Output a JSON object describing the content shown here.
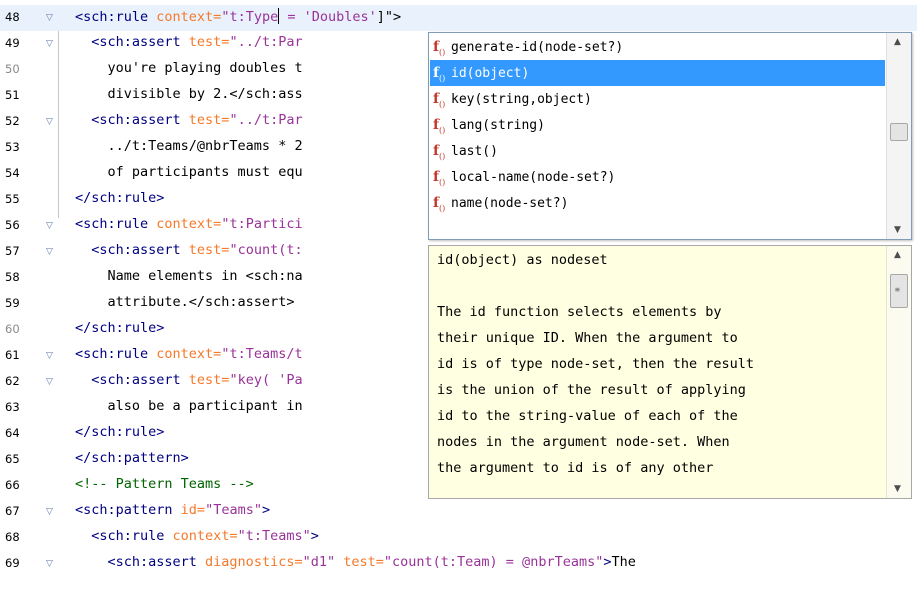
{
  "editor": {
    "lines": [
      {
        "num": "48",
        "fold": true,
        "dim": false,
        "current": true,
        "tokens": [
          [
            "tag",
            "<sch:rule "
          ],
          [
            "attr",
            "context="
          ],
          [
            "val",
            "\"t:Type"
          ],
          [
            "caret",
            ""
          ],
          [
            "val",
            " = 'Doubles'"
          ],
          [
            "text",
            "]\">"
          ]
        ]
      },
      {
        "num": "49",
        "fold": true,
        "dim": false,
        "current": false,
        "tokens": [
          [
            "tag",
            "  <sch:assert "
          ],
          [
            "attr",
            "test="
          ],
          [
            "val",
            "\"../t:Par"
          ]
        ]
      },
      {
        "num": "50",
        "fold": false,
        "dim": true,
        "current": false,
        "tokens": [
          [
            "text",
            "    you're playing doubles t"
          ]
        ]
      },
      {
        "num": "51",
        "fold": false,
        "dim": false,
        "current": false,
        "tokens": [
          [
            "text",
            "    divisible by 2.</sch:ass"
          ]
        ]
      },
      {
        "num": "52",
        "fold": true,
        "dim": false,
        "current": false,
        "tokens": [
          [
            "tag",
            "  <sch:assert "
          ],
          [
            "attr",
            "test="
          ],
          [
            "val",
            "\"../t:Par"
          ]
        ]
      },
      {
        "num": "53",
        "fold": false,
        "dim": false,
        "current": false,
        "tokens": [
          [
            "text",
            "    ../t:Teams/@nbrTeams * 2"
          ]
        ]
      },
      {
        "num": "54",
        "fold": false,
        "dim": false,
        "current": false,
        "tokens": [
          [
            "text",
            "    of participants must equ"
          ]
        ]
      },
      {
        "num": "55",
        "fold": false,
        "dim": false,
        "current": false,
        "tokens": [
          [
            "tag",
            "</sch:rule>"
          ]
        ]
      },
      {
        "num": "56",
        "fold": true,
        "dim": false,
        "current": false,
        "tokens": [
          [
            "tag",
            "<sch:rule "
          ],
          [
            "attr",
            "context="
          ],
          [
            "val",
            "\"t:Partici"
          ]
        ]
      },
      {
        "num": "57",
        "fold": true,
        "dim": false,
        "current": false,
        "tokens": [
          [
            "tag",
            "  <sch:assert "
          ],
          [
            "attr",
            "test="
          ],
          [
            "val",
            "\"count(t:"
          ]
        ]
      },
      {
        "num": "58",
        "fold": false,
        "dim": false,
        "current": false,
        "tokens": [
          [
            "text",
            "    Name elements in <sch:na"
          ]
        ]
      },
      {
        "num": "59",
        "fold": false,
        "dim": false,
        "current": false,
        "tokens": [
          [
            "text",
            "    attribute.</sch:assert>"
          ]
        ]
      },
      {
        "num": "60",
        "fold": false,
        "dim": true,
        "current": false,
        "tokens": [
          [
            "tag",
            "</sch:rule>"
          ]
        ]
      },
      {
        "num": "61",
        "fold": true,
        "dim": false,
        "current": false,
        "tokens": [
          [
            "tag",
            "<sch:rule "
          ],
          [
            "attr",
            "context="
          ],
          [
            "val",
            "\"t:Teams/t"
          ]
        ]
      },
      {
        "num": "62",
        "fold": true,
        "dim": false,
        "current": false,
        "tokens": [
          [
            "tag",
            "  <sch:assert "
          ],
          [
            "attr",
            "test="
          ],
          [
            "val",
            "\"key( 'Pa"
          ]
        ]
      },
      {
        "num": "63",
        "fold": false,
        "dim": false,
        "current": false,
        "tokens": [
          [
            "text",
            "    also be a participant in"
          ]
        ]
      },
      {
        "num": "64",
        "fold": false,
        "dim": false,
        "current": false,
        "tokens": [
          [
            "tag",
            "</sch:rule>"
          ]
        ]
      },
      {
        "num": "65",
        "fold": false,
        "dim": false,
        "current": false,
        "tokens": [
          [
            "tag",
            "</sch:pattern>"
          ]
        ]
      },
      {
        "num": "66",
        "fold": false,
        "dim": false,
        "current": false,
        "tokens": [
          [
            "comment",
            "<!-- Pattern Teams -->"
          ]
        ]
      },
      {
        "num": "67",
        "fold": true,
        "dim": false,
        "current": false,
        "tokens": [
          [
            "tag",
            "<sch:pattern "
          ],
          [
            "attr",
            "id="
          ],
          [
            "val",
            "\"Teams\""
          ],
          [
            "tag",
            ">"
          ]
        ]
      },
      {
        "num": "68",
        "fold": false,
        "dim": false,
        "current": false,
        "tokens": [
          [
            "tag",
            "  <sch:rule "
          ],
          [
            "attr",
            "context="
          ],
          [
            "val",
            "\"t:Teams\""
          ],
          [
            "tag",
            ">"
          ]
        ]
      },
      {
        "num": "69",
        "fold": true,
        "dim": false,
        "current": false,
        "tokens": [
          [
            "tag",
            "    <sch:assert "
          ],
          [
            "attr",
            "diagnostics="
          ],
          [
            "val",
            "\"d1\""
          ],
          [
            "attr",
            " test="
          ],
          [
            "val",
            "\"count(t:Team) = @nbrTeams\""
          ],
          [
            "tag",
            ">"
          ],
          [
            "text",
            "The"
          ]
        ]
      }
    ]
  },
  "completion": {
    "items": [
      {
        "label": "generate-id(node-set?)",
        "icon": "function-icon",
        "selected": false
      },
      {
        "label": "id(object)",
        "icon": "function-icon",
        "selected": true
      },
      {
        "label": "key(string,object)",
        "icon": "function-icon",
        "selected": false
      },
      {
        "label": "lang(string)",
        "icon": "function-icon",
        "selected": false
      },
      {
        "label": "last()",
        "icon": "function-icon",
        "selected": false
      },
      {
        "label": "local-name(node-set?)",
        "icon": "function-icon",
        "selected": false
      },
      {
        "label": "name(node-set?)",
        "icon": "function-icon",
        "selected": false
      }
    ],
    "scroll_position": 0.45
  },
  "doc": {
    "lines": [
      "id(object) as nodeset",
      "",
      "The id function selects elements by",
      "their unique ID. When the argument to",
      "id is of type node-set, then the result",
      "is the union of the result of applying",
      "id to the string-value of each of the",
      "nodes in the argument node-set. When",
      "the argument to id is of any other"
    ],
    "scroll_position": 0.05
  },
  "colors": {
    "tag": "#000080",
    "attribute": "#f5792a",
    "value": "#993399",
    "comment": "#006400",
    "selection": "#3399ff",
    "doc_background": "#ffffe1"
  }
}
